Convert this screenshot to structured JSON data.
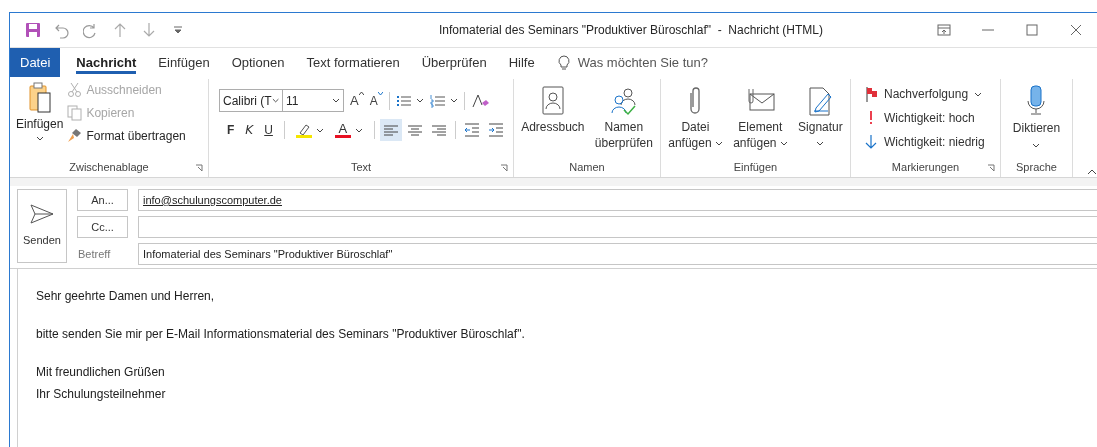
{
  "window": {
    "title": "Infomaterial des Seminars \"Produktiver Büroschlaf\"  -  Nachricht (HTML)"
  },
  "tabs": [
    {
      "label": "Datei",
      "kind": "file",
      "selected": false
    },
    {
      "label": "Nachricht",
      "kind": "tab",
      "selected": true
    },
    {
      "label": "Einfügen",
      "kind": "tab",
      "selected": false
    },
    {
      "label": "Optionen",
      "kind": "tab",
      "selected": false
    },
    {
      "label": "Text formatieren",
      "kind": "tab",
      "selected": false
    },
    {
      "label": "Überprüfen",
      "kind": "tab",
      "selected": false
    },
    {
      "label": "Hilfe",
      "kind": "tab",
      "selected": false
    }
  ],
  "tell_me": {
    "placeholder": "Was möchten Sie tun?"
  },
  "clipboard": {
    "label": "Zwischenablage",
    "paste": "Einfügen",
    "items": [
      {
        "label": "Ausschneiden",
        "kind": "cut",
        "disabled": true
      },
      {
        "label": "Kopieren",
        "kind": "copy",
        "disabled": true
      },
      {
        "label": "Format übertragen",
        "kind": "painter",
        "disabled": false
      }
    ]
  },
  "text": {
    "label": "Text",
    "font": "Calibri (T",
    "size": "11",
    "grow": "A",
    "shrink": "A",
    "styles": [
      "F",
      "K",
      "U"
    ],
    "font_color": "A",
    "alignments": [
      {
        "kind": "left",
        "selected": true
      },
      {
        "kind": "center",
        "selected": false
      },
      {
        "kind": "right",
        "selected": false
      }
    ]
  },
  "groups": [
    {
      "label": "Namen",
      "buttons": [
        {
          "kind": "book",
          "lines": [
            "Adressbuch"
          ],
          "caret": false
        },
        {
          "kind": "people",
          "lines": [
            "Namen",
            "überprüfen"
          ],
          "caret": false
        }
      ]
    },
    {
      "label": "Einfügen",
      "buttons": [
        {
          "kind": "clip",
          "lines": [
            "Datei",
            "anfügen"
          ],
          "caret": true
        },
        {
          "kind": "envelope",
          "lines": [
            "Element",
            "anfügen"
          ],
          "caret": true
        },
        {
          "kind": "signature",
          "lines": [
            "Signatur"
          ],
          "caret": true
        }
      ]
    }
  ],
  "tags": {
    "label": "Markierungen",
    "items": [
      {
        "label": "Nachverfolgung",
        "kind": "flag",
        "caret": true
      },
      {
        "label": "Wichtigkeit: hoch",
        "kind": "high",
        "caret": false
      },
      {
        "label": "Wichtigkeit: niedrig",
        "kind": "low",
        "caret": false
      }
    ]
  },
  "voice": {
    "label": "Sprache",
    "button": "Diktieren"
  },
  "header": {
    "send": "Senden",
    "to_button": "An...",
    "to": "info@schulungscomputer.de",
    "cc_button": "Cc...",
    "subject_label": "Betreff",
    "subject": "Infomaterial des Seminars \"Produktiver Büroschlaf\""
  },
  "body": [
    [
      "Sehr geehrte Damen und Herren,"
    ],
    [
      "bitte senden Sie mir per E-Mail Informationsmaterial des Seminars \"Produktiver Büroschlaf\"."
    ],
    [
      "Mit freundlichen Grüßen",
      "Ihr Schulungsteilnehmer"
    ]
  ]
}
